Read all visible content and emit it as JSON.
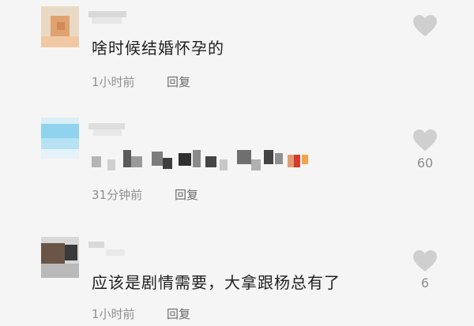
{
  "comments": [
    {
      "text": "啥时候结婚怀孕的",
      "time": "1小时前",
      "reply": "回复",
      "likes": ""
    },
    {
      "text": "",
      "time": "31分钟前",
      "reply": "回复",
      "likes": "60"
    },
    {
      "text": "应该是剧情需要，大拿跟杨总有了",
      "time": "1小时前",
      "reply": "回复",
      "likes": "6"
    }
  ],
  "icons": {
    "like": "heart-icon",
    "avatar": "avatar-pixelated"
  },
  "colors": {
    "background": "#f5f5f5",
    "heart": "#cfcfcf",
    "meta": "#8f8f8f",
    "text": "#1f1f1f"
  }
}
